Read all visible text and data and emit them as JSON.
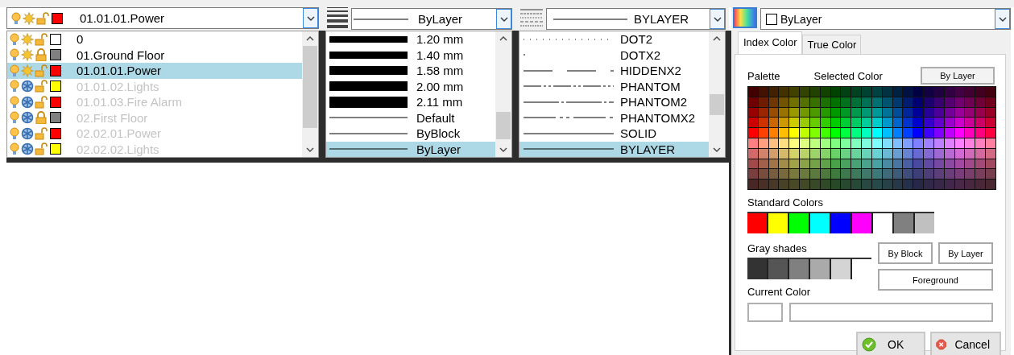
{
  "layer_combo": {
    "name": "01.01.01.Power",
    "on": true,
    "frozen": false,
    "locked": false,
    "color": "#ff0000"
  },
  "layers": [
    {
      "name": "0",
      "on": true,
      "frozen": false,
      "locked": false,
      "color": "#ffffff",
      "selected": false
    },
    {
      "name": "01.Ground Floor",
      "on": true,
      "frozen": false,
      "locked": true,
      "color": "#808080",
      "selected": false
    },
    {
      "name": "01.01.01.Power",
      "on": true,
      "frozen": false,
      "locked": false,
      "color": "#ff0000",
      "selected": true
    },
    {
      "name": "01.01.02.Lights",
      "on": true,
      "frozen": true,
      "locked": false,
      "color": "#ffff00",
      "selected": false
    },
    {
      "name": "01.01.03.Fire Alarm",
      "on": true,
      "frozen": true,
      "locked": false,
      "color": "#ff0000",
      "selected": false
    },
    {
      "name": "02.First Floor",
      "on": true,
      "frozen": true,
      "locked": true,
      "color": "#808080",
      "selected": false
    },
    {
      "name": "02.02.01.Power",
      "on": true,
      "frozen": true,
      "locked": false,
      "color": "#ff0000",
      "selected": false
    },
    {
      "name": "02.02.02.Lights",
      "on": true,
      "frozen": true,
      "locked": false,
      "color": "#ffff00",
      "selected": false
    }
  ],
  "lineweight_combo": {
    "value": "ByLayer"
  },
  "lineweights": [
    {
      "label": "1.20 mm",
      "kind": "bar",
      "selected": false
    },
    {
      "label": "1.40 mm",
      "kind": "bar",
      "selected": false
    },
    {
      "label": "1.58 mm",
      "kind": "bar",
      "selected": false
    },
    {
      "label": "2.00 mm",
      "kind": "bar",
      "selected": false
    },
    {
      "label": "2.11 mm",
      "kind": "bar",
      "selected": false
    },
    {
      "label": "Default",
      "kind": "line",
      "selected": false
    },
    {
      "label": "ByBlock",
      "kind": "line",
      "selected": false
    },
    {
      "label": "ByLayer",
      "kind": "line",
      "selected": true
    }
  ],
  "linetype_combo": {
    "value": "BYLAYER",
    "kind": "solid"
  },
  "linetypes": [
    {
      "name": "DOT2",
      "kind": "dot2",
      "selected": false
    },
    {
      "name": "DOTX2",
      "kind": "dotx2",
      "selected": false
    },
    {
      "name": "HIDDENX2",
      "kind": "hiddenx2",
      "selected": false
    },
    {
      "name": "PHANTOM",
      "kind": "phantom",
      "selected": false
    },
    {
      "name": "PHANTOM2",
      "kind": "phantom2",
      "selected": false
    },
    {
      "name": "PHANTOMX2",
      "kind": "phantomx2",
      "selected": false
    },
    {
      "name": "SOLID",
      "kind": "solid",
      "selected": false
    },
    {
      "name": "BYLAYER",
      "kind": "solid",
      "selected": true
    }
  ],
  "color_combo": {
    "value": "ByLayer",
    "color": "#ffffff"
  },
  "color_panel": {
    "tabs": [
      {
        "label": "Index Color",
        "selected": true
      },
      {
        "label": "True Color",
        "selected": false
      }
    ],
    "palette_label": "Palette",
    "selected_color_label": "Selected Color",
    "selected_color_button": "By Layer",
    "standard_colors_label": "Standard Colors",
    "standard_colors": [
      {
        "color": "#ff0000"
      },
      {
        "color": "#ffff00"
      },
      {
        "color": "#00ff00"
      },
      {
        "color": "#00ffff"
      },
      {
        "color": "#0000ff"
      },
      {
        "color": "#ff00ff"
      },
      {
        "color": "#ffffff"
      },
      {
        "color": "#808080"
      },
      {
        "color": "#c0c0c0"
      }
    ],
    "gray_shades_label": "Gray shades",
    "gray_shades": [
      {
        "color": "#333333"
      },
      {
        "color": "#555555"
      },
      {
        "color": "#808080"
      },
      {
        "color": "#aaaaaa"
      },
      {
        "color": "#d4d4d4"
      },
      {
        "color": "#ffffff"
      }
    ],
    "by_block_button": "By Block",
    "by_layer_button": "By Layer",
    "foreground_button": "Foreground",
    "current_color_label": "Current Color",
    "ok_button": "OK",
    "cancel_button": "Cancel"
  }
}
